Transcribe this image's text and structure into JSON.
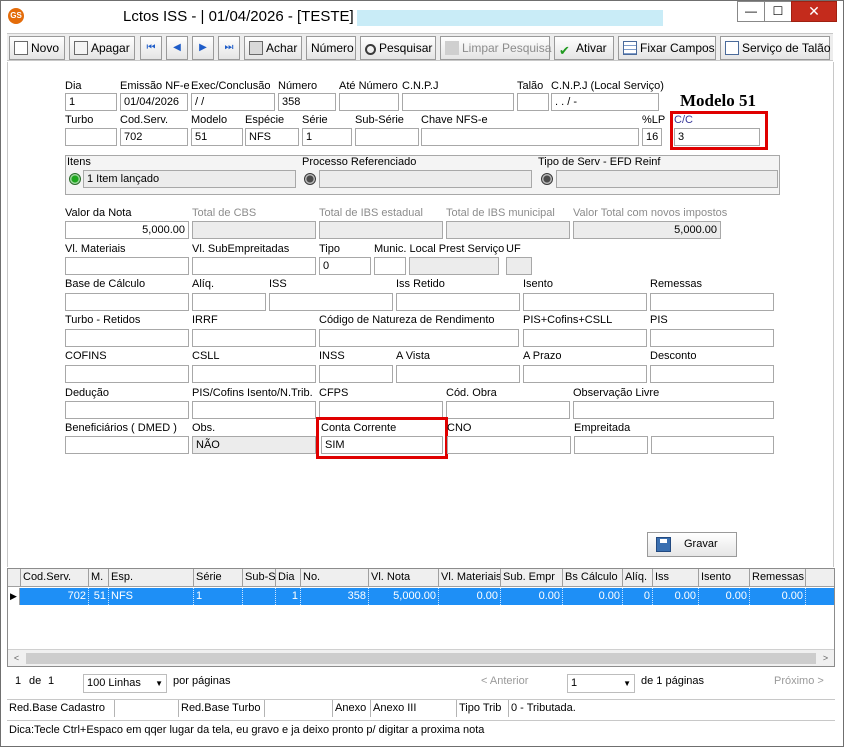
{
  "window": {
    "title": "Lctos ISS - |  01/04/2026 - [TESTE] -",
    "app_icon_text": "GS",
    "min_symbol": "—",
    "max_symbol": "☐",
    "close_symbol": "✕"
  },
  "toolbar": {
    "novo": "Novo",
    "apagar": "Apagar",
    "first": "⏮",
    "prev": "◀",
    "next": "▶",
    "last": "⏭",
    "achar": "Achar",
    "numero": "Número",
    "pesquisar": "Pesquisar",
    "limpar": "Limpar Pesquisa",
    "ativar": "Ativar",
    "fixar": "Fixar Campos",
    "servico": "Serviço de Talão"
  },
  "annotation": {
    "modelo_label": "Modelo 51"
  },
  "form": {
    "dia": {
      "label": "Dia",
      "value": "1"
    },
    "emissao": {
      "label": "Emissão NF-e",
      "value": "01/04/2026"
    },
    "exec": {
      "label": "Exec/Conclusão",
      "value": " / /"
    },
    "numero": {
      "label": "Número",
      "value": "358"
    },
    "ate_numero": {
      "label": "Até Número",
      "value": ""
    },
    "cnpj": {
      "label": "C.N.P.J",
      "value": ""
    },
    "talao": {
      "label": "Talão",
      "value": ""
    },
    "cnpj_local": {
      "label": "C.N.P.J (Local Serviço)",
      "value": "  .   .   /   -"
    },
    "turbo": {
      "label": "Turbo",
      "value": ""
    },
    "cod_serv": {
      "label": "Cod.Serv.",
      "value": "702"
    },
    "modelo": {
      "label": "Modelo",
      "value": "51"
    },
    "especie": {
      "label": "Espécie",
      "value": "NFS"
    },
    "serie": {
      "label": "Série",
      "value": "1"
    },
    "sub_serie": {
      "label": "Sub-Série",
      "value": ""
    },
    "chave": {
      "label": "Chave NFS-e",
      "value": ""
    },
    "lp": {
      "label": "%LP",
      "value": "16"
    },
    "cc": {
      "label": "C/C",
      "value": "3"
    },
    "itens": {
      "label": "Itens",
      "value": "1 Item lançado"
    },
    "processo": {
      "label": "Processo Referenciado",
      "value": ""
    },
    "tipo_serv": {
      "label": "Tipo de Serv - EFD Reinf",
      "value": ""
    },
    "valor_nota": {
      "label": "Valor da Nota",
      "value": "5,000.00"
    },
    "total_cbs": {
      "label": "Total de CBS",
      "value": ""
    },
    "total_ibs_est": {
      "label": "Total de IBS estadual",
      "value": ""
    },
    "total_ibs_mun": {
      "label": "Total de IBS municipal",
      "value": ""
    },
    "valor_total_novos": {
      "label": "Valor Total com novos impostos",
      "value": "5,000.00"
    },
    "vl_materiais": {
      "label": "Vl. Materiais",
      "value": ""
    },
    "vl_subempreitadas": {
      "label": "Vl. SubEmpreitadas",
      "value": ""
    },
    "tipo": {
      "label": "Tipo",
      "value": "0"
    },
    "munic_local": {
      "label": "Munic. Local Prest Serviço",
      "value": ""
    },
    "uf": {
      "label": "UF",
      "value": ""
    },
    "base_calculo": {
      "label": "Base de Cálculo",
      "value": ""
    },
    "aliq": {
      "label": "Alíq.",
      "value": ""
    },
    "iss": {
      "label": "ISS",
      "value": ""
    },
    "iss_retido": {
      "label": "Iss Retido",
      "value": ""
    },
    "isento": {
      "label": "Isento",
      "value": ""
    },
    "remessas": {
      "label": "Remessas",
      "value": ""
    },
    "turbo_retidos": {
      "label": "Turbo - Retidos",
      "value": ""
    },
    "irrf": {
      "label": "IRRF",
      "value": ""
    },
    "cod_natureza": {
      "label": "Código de Natureza de Rendimento",
      "value": ""
    },
    "pis_cofins_csll": {
      "label": "PIS+Cofins+CSLL",
      "value": ""
    },
    "pis": {
      "label": "PIS",
      "value": ""
    },
    "cofins": {
      "label": "COFINS",
      "value": ""
    },
    "csll": {
      "label": "CSLL",
      "value": ""
    },
    "inss": {
      "label": "INSS",
      "value": ""
    },
    "a_vista": {
      "label": "A Vista",
      "value": ""
    },
    "a_prazo": {
      "label": "A Prazo",
      "value": ""
    },
    "desconto": {
      "label": "Desconto",
      "value": ""
    },
    "deducao": {
      "label": "Dedução",
      "value": ""
    },
    "pis_cofins_isento": {
      "label": "PIS/Cofins Isento/N.Trib.",
      "value": ""
    },
    "cfps": {
      "label": "CFPS",
      "value": ""
    },
    "cod_obra": {
      "label": "Cód. Obra",
      "value": ""
    },
    "obs_livre": {
      "label": "Observação Livre",
      "value": ""
    },
    "beneficiarios": {
      "label": "Beneficiários ( DMED )",
      "value": ""
    },
    "obs": {
      "label": "Obs.",
      "value": "NÃO"
    },
    "conta_corrente": {
      "label": "Conta Corrente",
      "value": "SIM"
    },
    "cno": {
      "label": "CNO",
      "value": ""
    },
    "empreitada": {
      "label": "Empreitada",
      "value": ""
    }
  },
  "save_button": "Gravar",
  "grid": {
    "columns": [
      "Cod.Serv.",
      "M.",
      "Esp.",
      "Série",
      "Sub-S",
      "Dia",
      "No.",
      "Vl. Nota",
      "Vl. Materiais",
      "Sub. Empr",
      "Bs Cálculo",
      "Alíq.",
      "Iss",
      "Isento",
      "Remessas"
    ],
    "row": [
      "702",
      "51",
      "NFS",
      "1",
      "",
      "1",
      "358",
      "5,000.00",
      "0.00",
      "0.00",
      "0.00",
      "0",
      "0.00",
      "0.00",
      "0.00"
    ],
    "row_indicator": "▶",
    "scroll_left": "<",
    "scroll_right": ">"
  },
  "pager": {
    "current": "1",
    "of": "de",
    "total": "1",
    "lines": "100 Linhas",
    "per_page": "por páginas",
    "anterior": "< Anterior",
    "page_select": "1",
    "of_pages": "de 1 páginas",
    "proximo": "Próximo >"
  },
  "status": {
    "red_base_cadastro": "Red.Base Cadastro",
    "red_base_turbo": "Red.Base Turbo",
    "anexo_label": "Anexo",
    "anexo_value": "Anexo III",
    "tipo_trib_label": "Tipo Trib",
    "tipo_trib_value": "0  - Tributada.",
    "dica": "Dica:Tecle Ctrl+Espaco em qqer lugar da tela, eu gravo  e ja deixo pronto p/ digitar a proxima nota"
  }
}
